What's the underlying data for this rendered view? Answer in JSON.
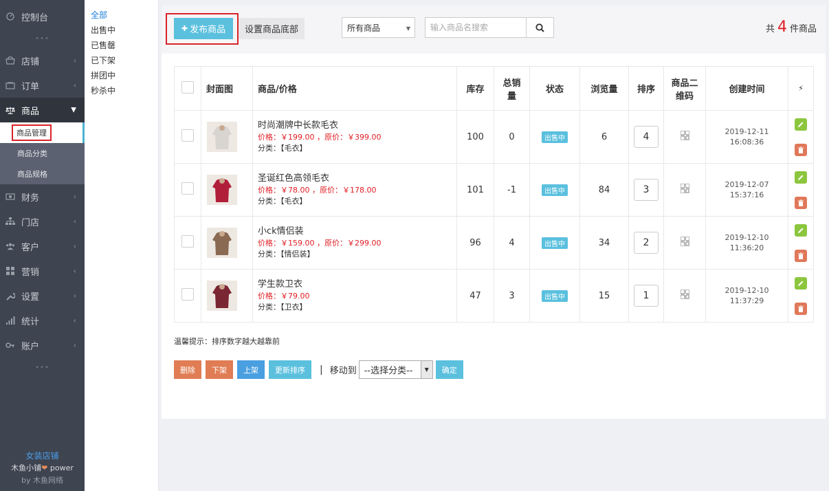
{
  "nav": {
    "items": [
      {
        "label": "控制台",
        "icon": "dashboard-icon"
      },
      {
        "label": "店铺",
        "icon": "store-icon"
      },
      {
        "label": "订单",
        "icon": "order-icon"
      },
      {
        "label": "商品",
        "icon": "scale-icon"
      },
      {
        "label": "财务",
        "icon": "money-icon"
      },
      {
        "label": "门店",
        "icon": "sitemap-icon"
      },
      {
        "label": "客户",
        "icon": "users-icon"
      },
      {
        "label": "营销",
        "icon": "marketing-icon"
      },
      {
        "label": "设置",
        "icon": "wrench-icon"
      },
      {
        "label": "统计",
        "icon": "signal-icon"
      },
      {
        "label": "账户",
        "icon": "key-icon"
      }
    ],
    "sub_items": [
      {
        "label": "商品管理"
      },
      {
        "label": "商品分类"
      },
      {
        "label": "商品规格"
      }
    ],
    "brand": {
      "shop": "女装店铺",
      "line1_a": "木鱼小铺",
      "heart": "❤",
      "line1_b": " power",
      "line2": "by 木鱼网络"
    }
  },
  "subnav": {
    "items": [
      {
        "label": "全部"
      },
      {
        "label": "出售中"
      },
      {
        "label": "已售罄"
      },
      {
        "label": "已下架"
      },
      {
        "label": "拼团中"
      },
      {
        "label": "秒杀中"
      }
    ]
  },
  "toolbar": {
    "publish_label": "发布商品",
    "publish_plus": "✚",
    "bottom_label": "设置商品底部",
    "filter_value": "所有商品",
    "search_placeholder": "输入商品名搜索",
    "total_prefix": "共",
    "total_count": "4",
    "total_suffix": "件商品"
  },
  "table": {
    "headers": {
      "cover": "封面图",
      "name": "商品/价格",
      "stock": "库存",
      "sales_1": "总销",
      "sales_2": "量",
      "status": "状态",
      "views": "浏览量",
      "sort": "排序",
      "qr_1": "商品二",
      "qr_2": "维码",
      "created": "创建时间",
      "actions": "⚡"
    },
    "rows": [
      {
        "name": "时尚潮牌中长款毛衣",
        "price": "价格：￥199.00 ，原价：￥399.00",
        "category": "分类：【毛衣】",
        "stock": "100",
        "sales": "0",
        "status": "出售中",
        "views": "6",
        "sort": "4",
        "date": "2019-12-11",
        "time": "16:08:36",
        "thumb_color": "#d8d4cf"
      },
      {
        "name": "圣诞红色高领毛衣",
        "price": "价格：￥78.00 ，原价：￥178.00",
        "category": "分类：【毛衣】",
        "stock": "101",
        "sales": "-1",
        "status": "出售中",
        "views": "84",
        "sort": "3",
        "date": "2019-12-07",
        "time": "15:37:16",
        "thumb_color": "#b01e3a"
      },
      {
        "name": "小ck情侣装",
        "price": "价格：￥159.00 ，原价：￥299.00",
        "category": "分类：【情侣装】",
        "stock": "96",
        "sales": "4",
        "status": "出售中",
        "views": "34",
        "sort": "2",
        "date": "2019-12-10",
        "time": "11:36:20",
        "thumb_color": "#8a6a52"
      },
      {
        "name": "学生款卫衣",
        "price": "价格：￥79.00",
        "category": "分类：【卫衣】",
        "stock": "47",
        "sales": "3",
        "status": "出售中",
        "views": "15",
        "sort": "1",
        "date": "2019-12-10",
        "time": "11:37:29",
        "thumb_color": "#7a2733"
      }
    ]
  },
  "tip": "温馨提示：排序数字越大越靠前",
  "bulk": {
    "delete": "删除",
    "down": "下架",
    "up": "上架",
    "resort": "更新排序",
    "separator": "|",
    "move_to": "移动到",
    "category_placeholder": "--选择分类--",
    "confirm": "确定"
  },
  "colors": {
    "accent": "#5bc0de",
    "danger": "#e01c23",
    "sidebar": "#3e4450"
  }
}
